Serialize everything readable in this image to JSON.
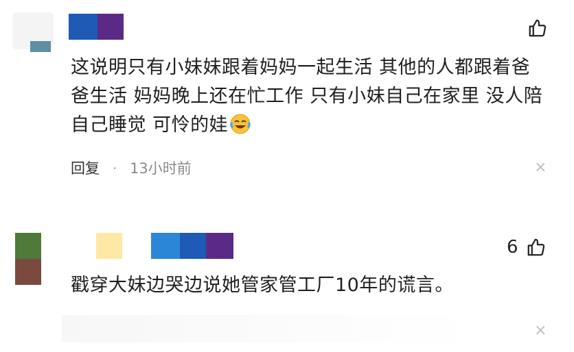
{
  "comments": [
    {
      "text_lines": [
        "这说明只有小妹妹跟着妈妈一起生活 其他的人都跟着爸",
        "爸生活 妈妈晚上还在忙工作 只有小妹自己在家里 没人陪",
        "自己睡觉 可怜的娃"
      ],
      "emoji": "laughing-crying-face",
      "reply_label": "回复",
      "separator": "·",
      "time": "13小时前",
      "like_count": "",
      "close_glyph": "×"
    },
    {
      "text": "戳穿大妹边哭边说她管家管工厂10年的谎言。",
      "like_count": "6",
      "close_glyph": "×"
    }
  ],
  "colors": {
    "blue": "#1e5ab6",
    "purple": "#5a2a86",
    "light_blue": "#2b86d8",
    "yellow": "#fde8a6",
    "green": "#4f7a3a",
    "brown": "#7b4a3e"
  }
}
